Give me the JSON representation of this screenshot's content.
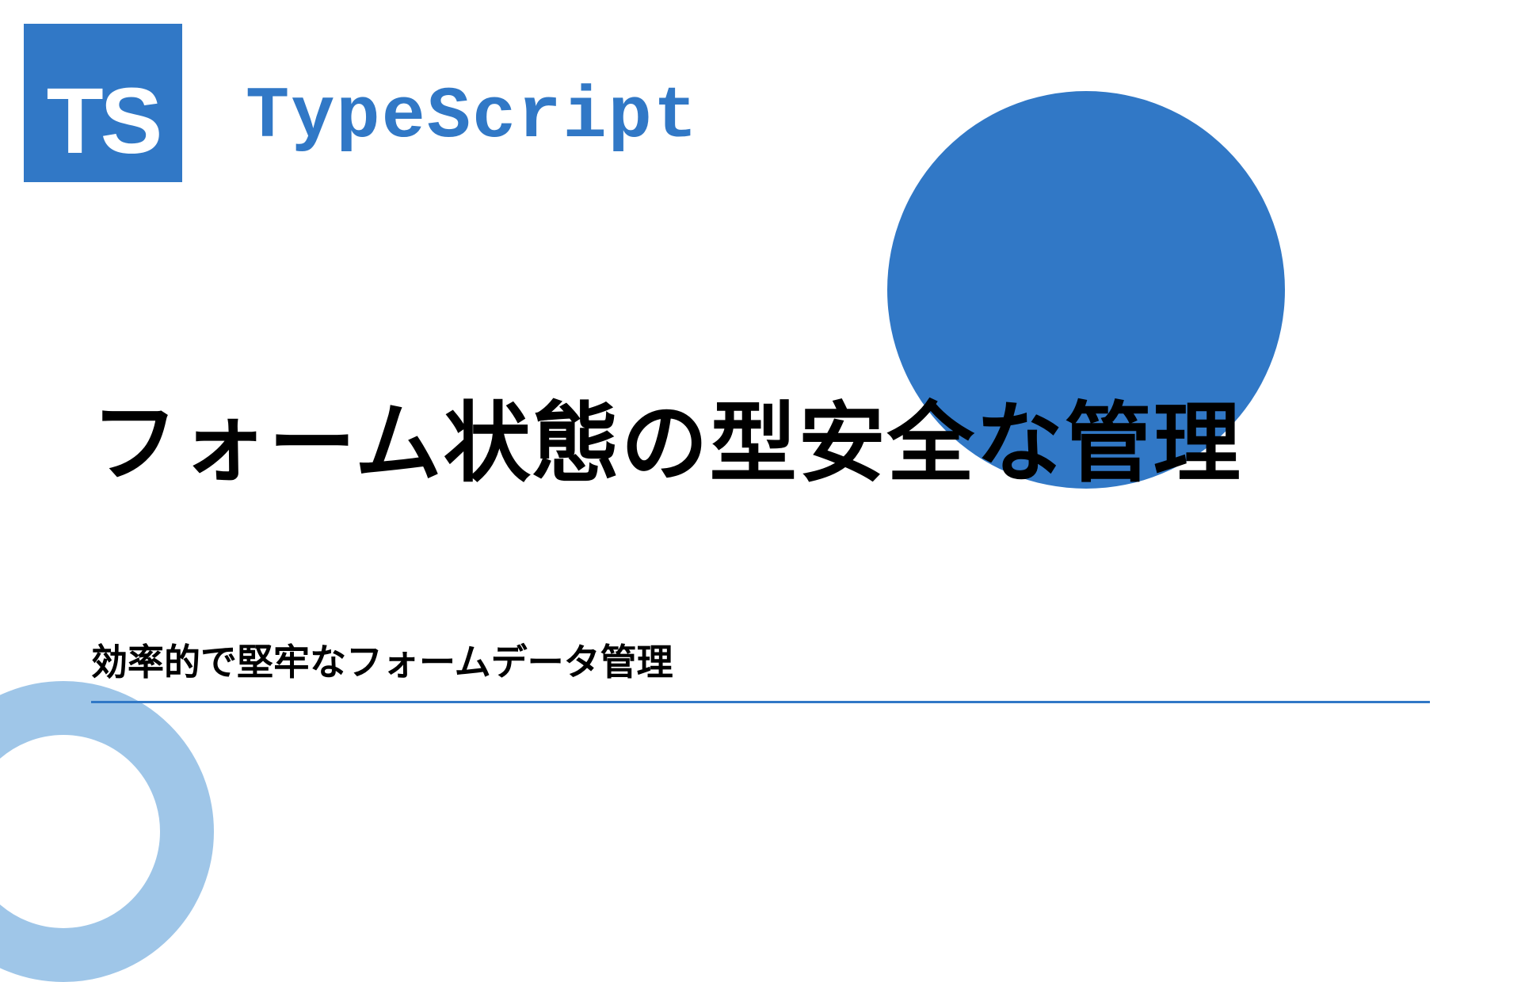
{
  "logo": {
    "text": "TS"
  },
  "header": {
    "typescript_label": "TypeScript"
  },
  "content": {
    "main_title": "フォーム状態の型安全な管理",
    "subtitle": "効率的で堅牢なフォームデータ管理"
  }
}
